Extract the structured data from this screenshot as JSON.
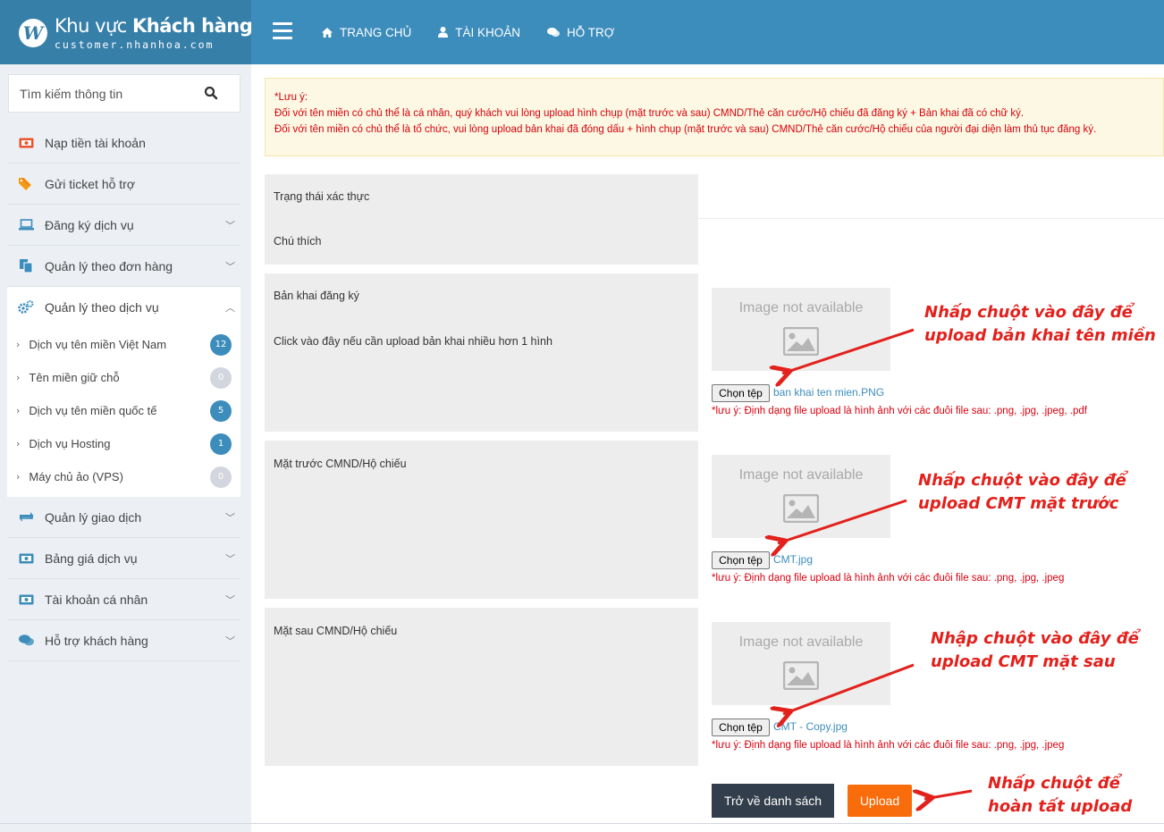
{
  "header": {
    "logo_letter": "W",
    "logo_title_light": "Khu vực ",
    "logo_title_bold": "Khách hàng",
    "logo_subtitle": "customer.nhanhoa.com",
    "nav": [
      {
        "label": "TRANG CHỦ",
        "icon": "home-icon"
      },
      {
        "label": "TÀI KHOẢN",
        "icon": "user-icon"
      },
      {
        "label": "HỖ TRỢ",
        "icon": "chat-icon"
      }
    ]
  },
  "sidebar": {
    "search_placeholder": "Tìm kiếm thông tin",
    "items": [
      {
        "label": "Nạp tiền tài khoản",
        "icon": "money-icon"
      },
      {
        "label": "Gửi ticket hỗ trợ",
        "icon": "tag-icon"
      },
      {
        "label": "Đăng ký dịch vụ",
        "icon": "laptop-icon"
      },
      {
        "label": "Quản lý theo đơn hàng",
        "icon": "copy-icon"
      },
      {
        "label": "Quản lý theo dịch vụ",
        "icon": "cogs-icon"
      },
      {
        "label": "Quản lý giao dịch",
        "icon": "exchange-icon"
      },
      {
        "label": "Bảng giá dịch vụ",
        "icon": "money-icon"
      },
      {
        "label": "Tài khoản cá nhân",
        "icon": "money-icon"
      },
      {
        "label": "Hỗ trợ khách hàng",
        "icon": "chat-icon"
      }
    ],
    "subitems": [
      {
        "label": "Dịch vụ tên miền Việt Nam",
        "count": "12",
        "color": "#3c8dbc"
      },
      {
        "label": "Tên miền giữ chỗ",
        "count": "0",
        "color": "#d2d6de"
      },
      {
        "label": "Dịch vụ tên miền quốc tế",
        "count": "5",
        "color": "#3c8dbc"
      },
      {
        "label": "Dịch vụ Hosting",
        "count": "1",
        "color": "#3c8dbc"
      },
      {
        "label": "Máy chủ ảo (VPS)",
        "count": "0",
        "color": "#d2d6de"
      }
    ]
  },
  "notice": {
    "title": "*Lưu ý:",
    "line1": "Đối với tên miền có chủ thể là cá nhân, quý khách vui lòng upload hình chụp (mặt trước và sau) CMND/Thẻ căn cước/Hộ chiếu đã đăng ký + Bản khai đã có chữ ký.",
    "line2": "Đối với tên miền có chủ thể là tổ chức, vui lòng upload bản khai đã đóng dấu + hình chụp (mặt trước và sau) CMND/Thẻ căn cước/Hộ chiếu của người đại diện làm thủ tục đăng ký."
  },
  "form": {
    "status_label": "Trạng thái xác thực",
    "comment_label": "Chú thích",
    "image_placeholder": "Image not available",
    "choose_file": "Chọn tệp",
    "sections": [
      {
        "label": "Bản khai đăng ký",
        "file": "ban khai ten mien.PNG",
        "format_note": "*lưu ý: Định dạng file upload là hình ảnh với các đuôi file sau: .png, .jpg, .jpeg, .pdf",
        "annotation_1": "Nhấp chuột vào đây để",
        "annotation_2": "upload bản khai tên miền"
      },
      {
        "label": "Mặt trước CMND/Hộ chiếu",
        "file": "CMT.jpg",
        "format_note": "*lưu ý: Định dạng file upload là hình ảnh với các đuôi file sau: .png, .jpg, .jpeg",
        "annotation_1": "Nhấp chuột vào đây để",
        "annotation_2": "upload CMT mặt trước"
      },
      {
        "label": "Mặt sau CMND/Hộ chiếu",
        "file": "CMT - Copy.jpg",
        "format_note": "*lưu ý: Định dạng file upload là hình ảnh với các đuôi file sau: .png, .jpg, .jpeg",
        "annotation_1": "Nhập chuột vào đây để",
        "annotation_2": "upload CMT mặt sau"
      }
    ],
    "more_link": "Click vào đây nếu cần upload bản khai nhiều hơn 1 hình",
    "back_button": "Trở về danh sách",
    "upload_button": "Upload",
    "upload_annotation_1": "Nhấp chuột để",
    "upload_annotation_2": "hoàn tất upload"
  },
  "colors": {
    "header": "#3c8dbc",
    "accent_red": "#e2211c",
    "upload": "#f96c0b",
    "back": "#323e4b"
  }
}
